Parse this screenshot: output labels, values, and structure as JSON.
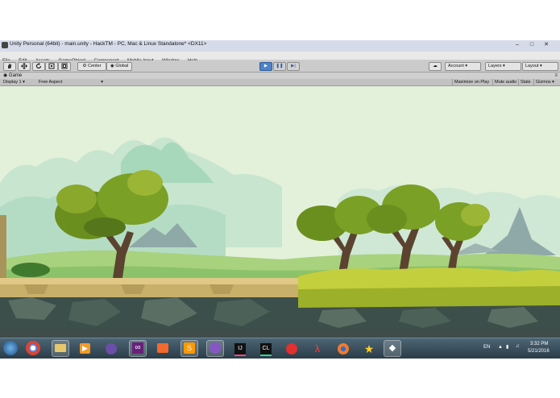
{
  "window": {
    "title": "Unity Personal (64bit) - main.unity - HackTM - PC, Mac & Linux Standalone* <DX11>",
    "minimize": "–",
    "maximize": "□",
    "close": "✕"
  },
  "menu": [
    "File",
    "Edit",
    "Assets",
    "GameObject",
    "Component",
    "Mobile Input",
    "Window",
    "Help"
  ],
  "toolbar": {
    "tools": [
      "hand-icon",
      "move-icon",
      "rotate-icon",
      "scale-icon",
      "rect-icon"
    ],
    "pivot_label": "Center",
    "space_label": "Global",
    "play_state": "playing",
    "cloud_icon": "cloud-icon",
    "account_label": "Account",
    "layers_label": "Layers",
    "layout_label": "Layout"
  },
  "game_view": {
    "tab_label": "Game",
    "display_label": "Display 1",
    "aspect_label": "Free Aspect",
    "maximize_on_play": "Maximize on Play",
    "mute_audio": "Mute audio",
    "stats": "Stats",
    "gizmos": "Gizmos"
  },
  "taskbar": {
    "apps": [
      "windows-start-icon",
      "chrome-icon",
      "file-explorer-icon",
      "media-player-icon",
      "app-icon",
      "visual-studio-icon",
      "sublime-icon",
      "sketch-icon",
      "app-icon",
      "intellij-icon",
      "clion-icon",
      "game-icon",
      "app-icon",
      "blender-icon",
      "app-icon",
      "unity-icon"
    ],
    "language": "EN",
    "time": "3:32 PM",
    "date": "5/21/2016"
  },
  "colors": {
    "sky": "#e5f2dc",
    "titlebar": "#d6dbe9",
    "toolbar": "#cbcbcb",
    "play_blue": "#4f82c8",
    "taskbar": "#2f4452"
  }
}
